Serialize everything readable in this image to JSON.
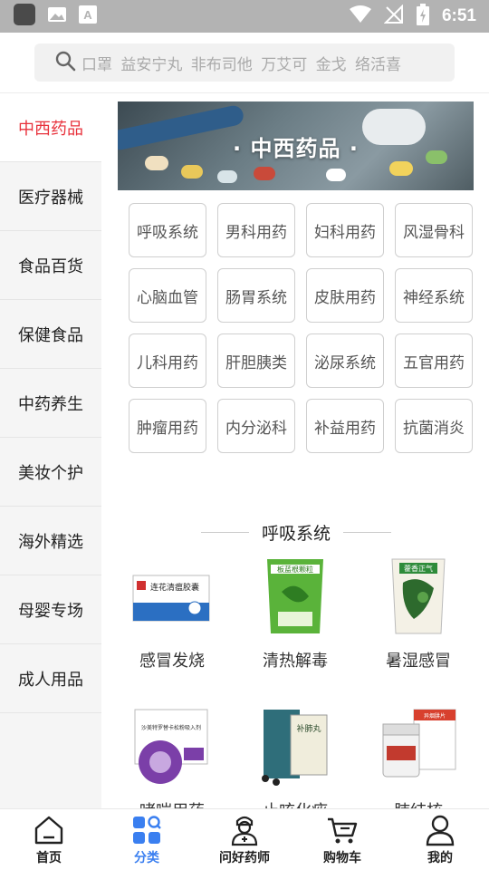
{
  "status_bar": {
    "time": "6:51"
  },
  "search": {
    "placeholder": "口罩   益安宁丸   非布司他   万艾可 金戈 络活喜"
  },
  "sidebar": {
    "items": [
      {
        "label": "中西药品",
        "active": true
      },
      {
        "label": "医疗器械"
      },
      {
        "label": "食品百货"
      },
      {
        "label": "保健食品"
      },
      {
        "label": "中药养生"
      },
      {
        "label": "美妆个护"
      },
      {
        "label": "海外精选"
      },
      {
        "label": "母婴专场"
      },
      {
        "label": "成人用品"
      }
    ]
  },
  "banner": {
    "title": "· 中西药品 ·"
  },
  "subcategories": [
    "呼吸系统",
    "男科用药",
    "妇科用药",
    "风湿骨科",
    "心脑血管",
    "肠胃系统",
    "皮肤用药",
    "神经系统",
    "儿科用药",
    "肝胆胰类",
    "泌尿系统",
    "五官用药",
    "肿瘤用药",
    "内分泌科",
    "补益用药",
    "抗菌消炎"
  ],
  "section": {
    "title": "呼吸系统"
  },
  "products": [
    {
      "label": "感冒发烧",
      "box_text": "连花清瘟胶囊"
    },
    {
      "label": "清热解毒",
      "box_text": "板蓝根颗粒"
    },
    {
      "label": "暑湿感冒",
      "box_text": "藿香正气"
    },
    {
      "label": "哮喘用药",
      "box_text": "沙美特罗替卡松粉吸入剂"
    },
    {
      "label": "止咳化痰",
      "box_text": "补肺丸"
    },
    {
      "label": "肺结核",
      "box_text": "异烟肼片"
    }
  ],
  "tabbar": {
    "items": [
      {
        "label": "首页",
        "icon": "home-icon"
      },
      {
        "label": "分类",
        "icon": "category-icon",
        "active": true
      },
      {
        "label": "问好药师",
        "icon": "pharmacist-icon"
      },
      {
        "label": "购物车",
        "icon": "cart-icon"
      },
      {
        "label": "我的",
        "icon": "user-icon"
      }
    ]
  },
  "colors": {
    "accent": "#e8323c",
    "tab_active": "#3a7ff0"
  }
}
